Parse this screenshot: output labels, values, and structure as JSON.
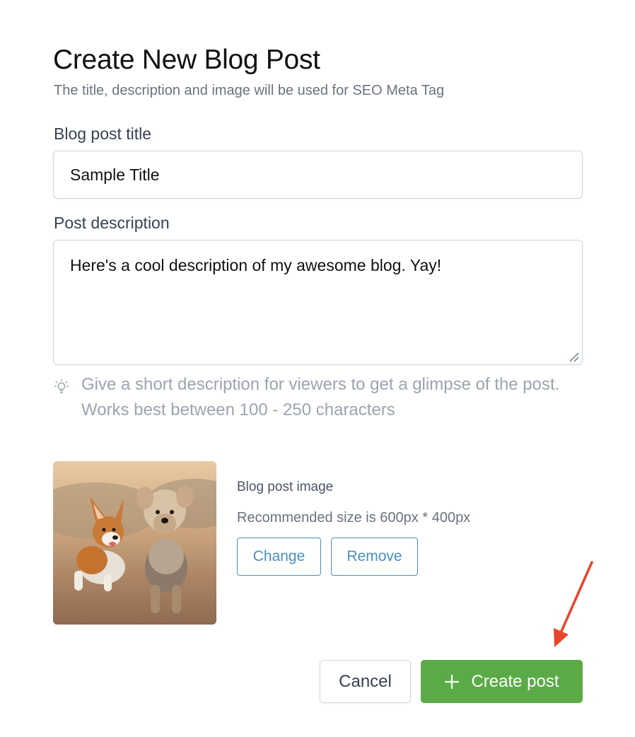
{
  "form": {
    "title": "Create New Blog Post",
    "subtitle": "The title, description and image will be used for SEO Meta Tag",
    "title_label": "Blog post title",
    "title_value": "Sample Title",
    "description_label": "Post description",
    "description_value": "Here's a cool description of my awesome blog. Yay!",
    "hint_icon": "lightbulb-icon",
    "hint": "Give a short description for viewers to get a glimpse of the post. Works best between 100 - 250 characters"
  },
  "image_section": {
    "label": "Blog post image",
    "recommendation": "Recommended size is 600px * 400px",
    "change_label": "Change",
    "remove_label": "Remove"
  },
  "actions": {
    "cancel_label": "Cancel",
    "create_label": "Create post",
    "create_icon": "plus-icon"
  },
  "colors": {
    "primary_green": "#5aab47",
    "outline_blue": "#4a90c2",
    "annotation_arrow": "#e8442c"
  }
}
